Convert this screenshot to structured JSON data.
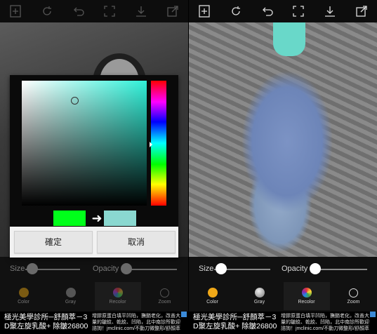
{
  "left": {
    "toolbar_icons": [
      "add-image-icon",
      "rotate-icon",
      "undo-icon",
      "fullscreen-icon",
      "download-icon",
      "share-icon"
    ],
    "dialog": {
      "ok_label": "確定",
      "cancel_label": "取消",
      "old_color": "#00ff1a",
      "new_color": "#8ad8d0"
    },
    "sliders": {
      "size_label": "Size",
      "opacity_label": "Opacity"
    },
    "nav": [
      {
        "label": "Color",
        "icon": "color-icon"
      },
      {
        "label": "Gray",
        "icon": "gray-icon"
      },
      {
        "label": "Recolor",
        "icon": "recolor-icon"
      },
      {
        "label": "Zoom",
        "icon": "zoom-icon"
      }
    ],
    "ad": {
      "title": "極光美學診所─舒顏萃－3 D聚左旋乳酸+ 除皺26800",
      "body": "增膠原蛋白填平凹陷，撫銷老化，改善大量的皺紋、乾紋、凹陷，北中南診所歡迎諮詢！jmclinic.com/不動刀微整形/舒顏萃"
    }
  },
  "right": {
    "toolbar_icons": [
      "add-image-icon",
      "rotate-icon",
      "undo-icon",
      "fullscreen-icon",
      "download-icon",
      "share-icon"
    ],
    "sliders": {
      "size_label": "Size",
      "opacity_label": "Opacity"
    },
    "nav": [
      {
        "label": "Color",
        "icon": "color-icon"
      },
      {
        "label": "Gray",
        "icon": "gray-icon"
      },
      {
        "label": "Recolor",
        "icon": "recolor-icon"
      },
      {
        "label": "Zoom",
        "icon": "zoom-icon"
      }
    ],
    "ad": {
      "title": "極光美學診所─舒顏萃－3 D聚左旋乳酸+ 除皺26800",
      "body": "增膠原蛋白填平凹陷，撫銷老化，改善大量的皺紋、乾紋、凹陷，北中南診所歡迎諮詢！jmclinic.com/不動刀微整形/舒顏萃"
    }
  }
}
